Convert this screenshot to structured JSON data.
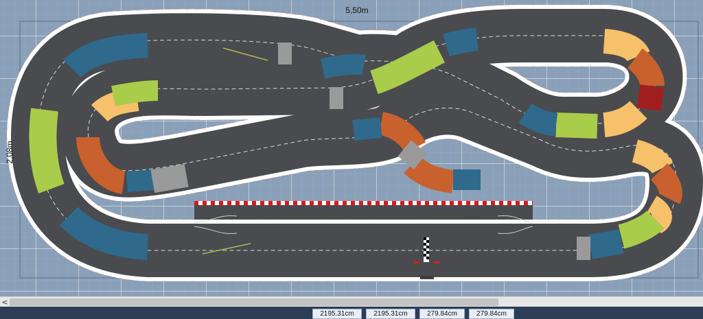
{
  "dimensions": {
    "width_label": "5,50m",
    "height_label": "2,08m"
  },
  "scrollbar": {
    "left_arrow": "<"
  },
  "status": {
    "values": [
      "2195.31cm",
      "2195.31cm",
      "279.84cm",
      "279.84cm"
    ]
  },
  "colors": {
    "background": "#8aa0b8",
    "grid": "#ffffff",
    "track": "#4a4b4e",
    "curb_red": "#e4161b",
    "curb_white": "#ffffff",
    "blue_curve": "#2f6a8c",
    "green_curve": "#a9cc4a",
    "orange_curve": "#f7c06a",
    "rust_curve": "#c8612e",
    "dark_red_curve": "#a01e1e",
    "lane_change": "#9a9a9a",
    "statusbar": "#2c3e55"
  }
}
